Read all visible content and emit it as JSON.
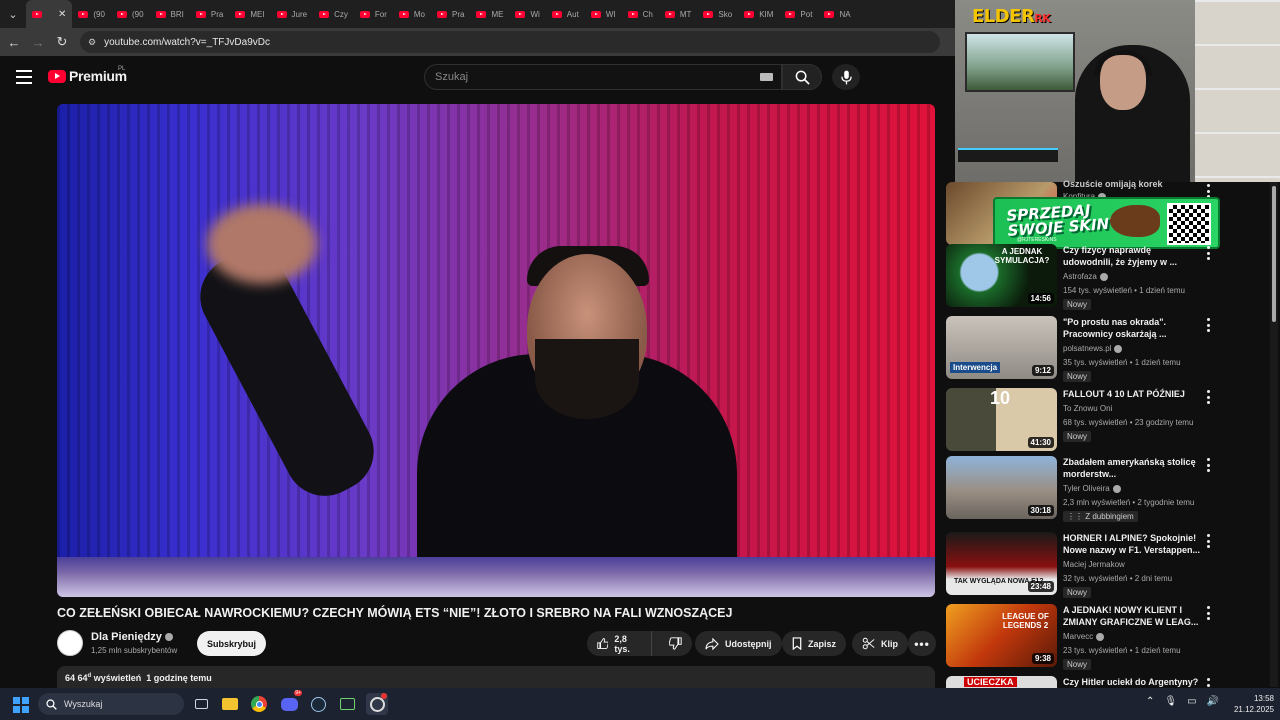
{
  "browser": {
    "tabs": [
      {
        "label": ""
      },
      {
        "label": "(90"
      },
      {
        "label": "(90"
      },
      {
        "label": "BRI"
      },
      {
        "label": "Pra"
      },
      {
        "label": "MEI"
      },
      {
        "label": "Jure"
      },
      {
        "label": "Czy"
      },
      {
        "label": "For"
      },
      {
        "label": "Mo"
      },
      {
        "label": "Pra"
      },
      {
        "label": "ME"
      },
      {
        "label": "Wi"
      },
      {
        "label": "Aut"
      },
      {
        "label": "WI"
      },
      {
        "label": "Ch"
      },
      {
        "label": "MT"
      },
      {
        "label": "Sko"
      },
      {
        "label": "KIM"
      },
      {
        "label": "Pot"
      },
      {
        "label": "NA"
      }
    ],
    "url": "youtube.com/watch?v=_TFJvDa9vDc"
  },
  "header": {
    "logo_text": "Premium",
    "logo_country": "PL",
    "search_placeholder": "Szukaj"
  },
  "video": {
    "title": "CO ZEŁEŃSKI OBIECAŁ NAWROCKIEMU? CZECHY MÓWIĄ ETS “NIE”! ZŁOTO I SREBRO NA FALI WZNOSZĄCEJ",
    "channel": "Dla Pieniędzy",
    "subscribers": "1,25 mln subskrybentów",
    "subscribe_label": "Subskrybuj",
    "likes": "2,8 tys.",
    "share_label": "Udostępnij",
    "save_label": "Zapisz",
    "clip_label": "Klip",
    "views": "64 64",
    "views_sup": "d",
    "views_word": "wyświetleń",
    "published": "1 godzinę temu"
  },
  "overlay": {
    "cam_logo": "ELDER",
    "cam_logo_suffix": "RK",
    "promo_line1": "SPRZEDAJ",
    "promo_line2": "SWOJE SKINY",
    "promo_small": "@RJTERESKINS"
  },
  "recommendations": [
    {
      "title": "Oszuście omijają korek",
      "channel": "Konfitura",
      "meta": "",
      "badge": "",
      "duration": ""
    },
    {
      "title": "Czy fizycy naprawdę udowodnili, że żyjemy w ...",
      "channel": "Astrofaza",
      "meta": "154 tys. wyświetleń • 1 dzień temu",
      "badge": "Nowy",
      "duration": "14:56",
      "thumb_text": "A JEDNAK SYMULACJA?"
    },
    {
      "title": "\"Po prostu nas okrada\". Pracownicy oskarżają ...",
      "channel": "polsatnews.pl",
      "meta": "35 tys. wyświetleń • 1 dzień temu",
      "badge": "Nowy",
      "duration": "9:12",
      "thumb_text": "Interwencja"
    },
    {
      "title": "FALLOUT 4 10 LAT PÓŹNIEJ",
      "channel": "To Znowu Oni",
      "meta": "68 tys. wyświetleń • 23 godziny temu",
      "badge": "Nowy",
      "duration": "41:30",
      "thumb_text": "10"
    },
    {
      "title": "Zbadałem amerykańską stolicę morderstw...",
      "channel": "Tyler Oliveira",
      "meta": "2,3 mln wyświetleń • 2 tygodnie temu",
      "badge": "Z dubbingiem",
      "duration": "30:18",
      "thumb_text": ""
    },
    {
      "title": "HORNER I ALPINE? Spokojnie! Nowe nazwy w F1. Verstappen...",
      "channel": "Maciej Jermakow",
      "meta": "32 tys. wyświetleń • 2 dni temu",
      "badge": "Nowy",
      "duration": "23:48",
      "thumb_text": "TAK WYGLĄDA NOWA F1?"
    },
    {
      "title": "A JEDNAK! NOWY KLIENT I ZMIANY GRAFICZNE W LEAG...",
      "channel": "Marvecc",
      "meta": "23 tys. wyświetleń • 1 dzień temu",
      "badge": "Nowy",
      "duration": "9:38",
      "thumb_text": "LEAGUE OF LEGENDS 2"
    },
    {
      "title": "Czy Hitler uciekł do Argentyny?",
      "channel": "",
      "meta": "",
      "badge": "",
      "duration": "",
      "thumb_text": "UCIECZKA"
    }
  ],
  "taskbar": {
    "search_placeholder": "Wyszukaj",
    "time": "13:58",
    "date": "21.12.2025",
    "discord_badge": "9+"
  },
  "colors": {
    "yt_red": "#ff0033",
    "background": "#0f0f0f",
    "promo_green": "#1cbf53",
    "cam_logo": "#f5c400"
  }
}
